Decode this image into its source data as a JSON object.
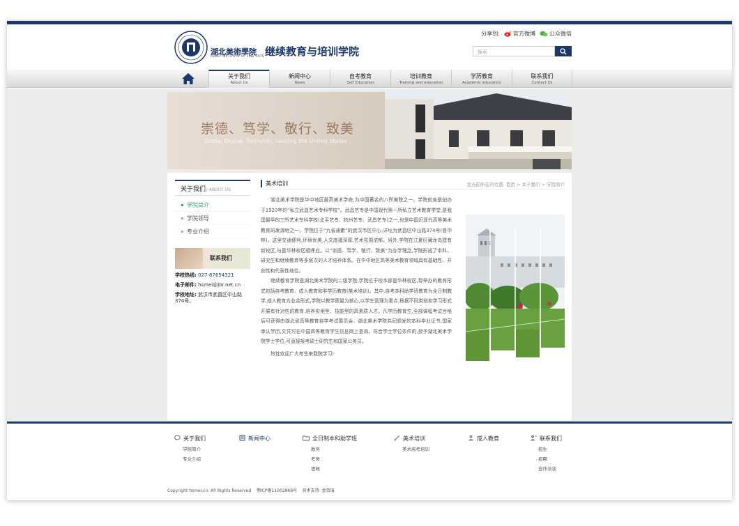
{
  "header": {
    "logo_cn": "湖北美術學院",
    "logo_en": "HUBEI INSTITUTE OF FINE ARTS",
    "title": "继续教育与培训学院",
    "share_label": "分享到:",
    "weibo": "官方微博",
    "wechat": "公众微信",
    "search_placeholder": "搜索"
  },
  "nav": [
    {
      "cn": "关于我们",
      "en": "About Us",
      "active": true
    },
    {
      "cn": "新闻中心",
      "en": "News"
    },
    {
      "cn": "自考教育",
      "en": "Self Education"
    },
    {
      "cn": "培训教育",
      "en": "Training and education"
    },
    {
      "cn": "学历教育",
      "en": "Academic education"
    },
    {
      "cn": "联系我们",
      "en": "Contact Us"
    }
  ],
  "banner": {
    "motto": "崇德、笃学、敬行、致美",
    "motto_en": "Zonta, Duxue, Toshiyuki, causing the United States"
  },
  "sidebar": {
    "title": "关于我们",
    "title_en": "/ ABOUT US",
    "items": [
      "学院简介",
      "学院领导",
      "专业介绍"
    ],
    "contact_label": "联系我们",
    "hotline_label": "学校热线:",
    "hotline": "027-87654321",
    "email_label": "电子邮件:",
    "email": "hsmei@jbr.net.cn",
    "address_label": "学校地址:",
    "address": "武汉市武昌区中山路374号。"
  },
  "main": {
    "title": "美术培训",
    "crumb": "您当前所在的位置: 首页 > 关于我们 > 学院简介",
    "p1": "湖北美术学院是华中地区最高美术学府,为中国著名的八所美院之一。学院前身是创办于1920年的“私立武昌艺术专科学校”。武昌艺专是中国现代第一所私立艺术教育学堂,是我国最早的三所艺术专科学校(北平艺专、杭州艺专、武昌艺专)之一,也是中国近现代高等美术教育的发源地之一。学院位于“九省通衢”的武汉市区中心,详址为武昌区中山路374号(昙华林)。这里交通便利,环境优美,人文底蕴深厚,艺术氛围浓郁。另外,学院在江夏区藏龙岛建有新校区,与昙华林校区相呼应。以“崇德、笃学、敬行、致美”为办学理念,学院形成了本科、研究生和继续教育等多层次的人才培养体系。在华中地区高等美术教育领域具有基础性、开创性和代表性地位。",
    "p2": "继续教育学院是湖北美术学院的二级学院,学院位于校本部昙华林校区,现举办的教育形式包括自考教育、成人教育和非学历教育(美术培训)。其中,自考本科助学班教育为全日制教学,成人教育为业余形式,学院以教学质量为核心,以学生管理为重点,根据不同类别和学习形式开展有针对性的教育,培养实用型、技能型的高素质人才。凡学历教育生,全部课程考试合格后可获得由湖北省高等教育自学考试委员会、湖北美术学院共同颁发的本科毕业证书,国家承认学历,文凭可在中国高等教育学生信息网上查询。符合学士学位条件的,授予湖北美术学院学士学位,可直接报考硕士研究生和国家公务员。",
    "p3": "热忱欢迎广大考生来我院学习!"
  },
  "footer": {
    "cols": [
      {
        "title": "关于我们",
        "icon": "chat-icon",
        "items": [
          "学院简介",
          "专业介绍"
        ]
      },
      {
        "title": "新闻中心",
        "icon": "news-icon",
        "items": []
      },
      {
        "title": "全日制本科助学班",
        "icon": "folder-icon",
        "items": [
          "教务",
          "考务",
          "思政"
        ]
      },
      {
        "title": "美术培训",
        "icon": "brush-icon",
        "items": [
          "美术高考培训"
        ]
      },
      {
        "title": "成人教育",
        "icon": "person-icon",
        "items": []
      },
      {
        "title": "联系我们",
        "icon": "contact-icon",
        "items": [
          "招生",
          "招聘",
          "合作洽谈"
        ]
      }
    ],
    "copyright": "Copyright hsmei.cn. All Rights Reserved",
    "icp": "鄂ICP备11002868号",
    "support": "技术支持: 金百瑞"
  },
  "colors": {
    "brand": "#1d3768",
    "accent": "#3aa06a",
    "footer_gray": "#ececec"
  }
}
